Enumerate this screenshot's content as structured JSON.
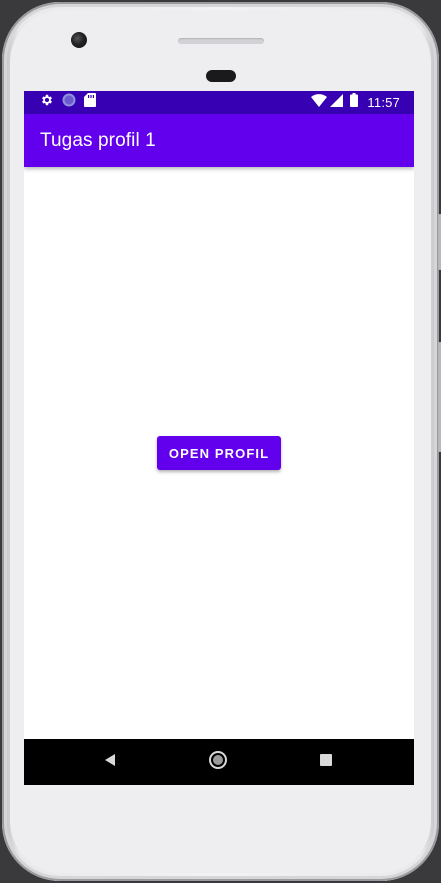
{
  "app": {
    "title": "Tugas profil 1"
  },
  "status_bar": {
    "time": "11:57",
    "left_icons": [
      "settings-icon",
      "circle-notification-icon",
      "sd-card-icon"
    ],
    "right_icons": [
      "wifi-icon",
      "signal-icon",
      "battery-icon"
    ]
  },
  "main": {
    "open_button_label": "OPEN PROFIL"
  },
  "navigation": {
    "buttons": [
      "back-icon",
      "home-icon",
      "recents-icon"
    ]
  },
  "colors": {
    "primary": "#6200ee",
    "primary_dark": "#3700b3",
    "background": "#ffffff",
    "nav_bar": "#000000"
  }
}
